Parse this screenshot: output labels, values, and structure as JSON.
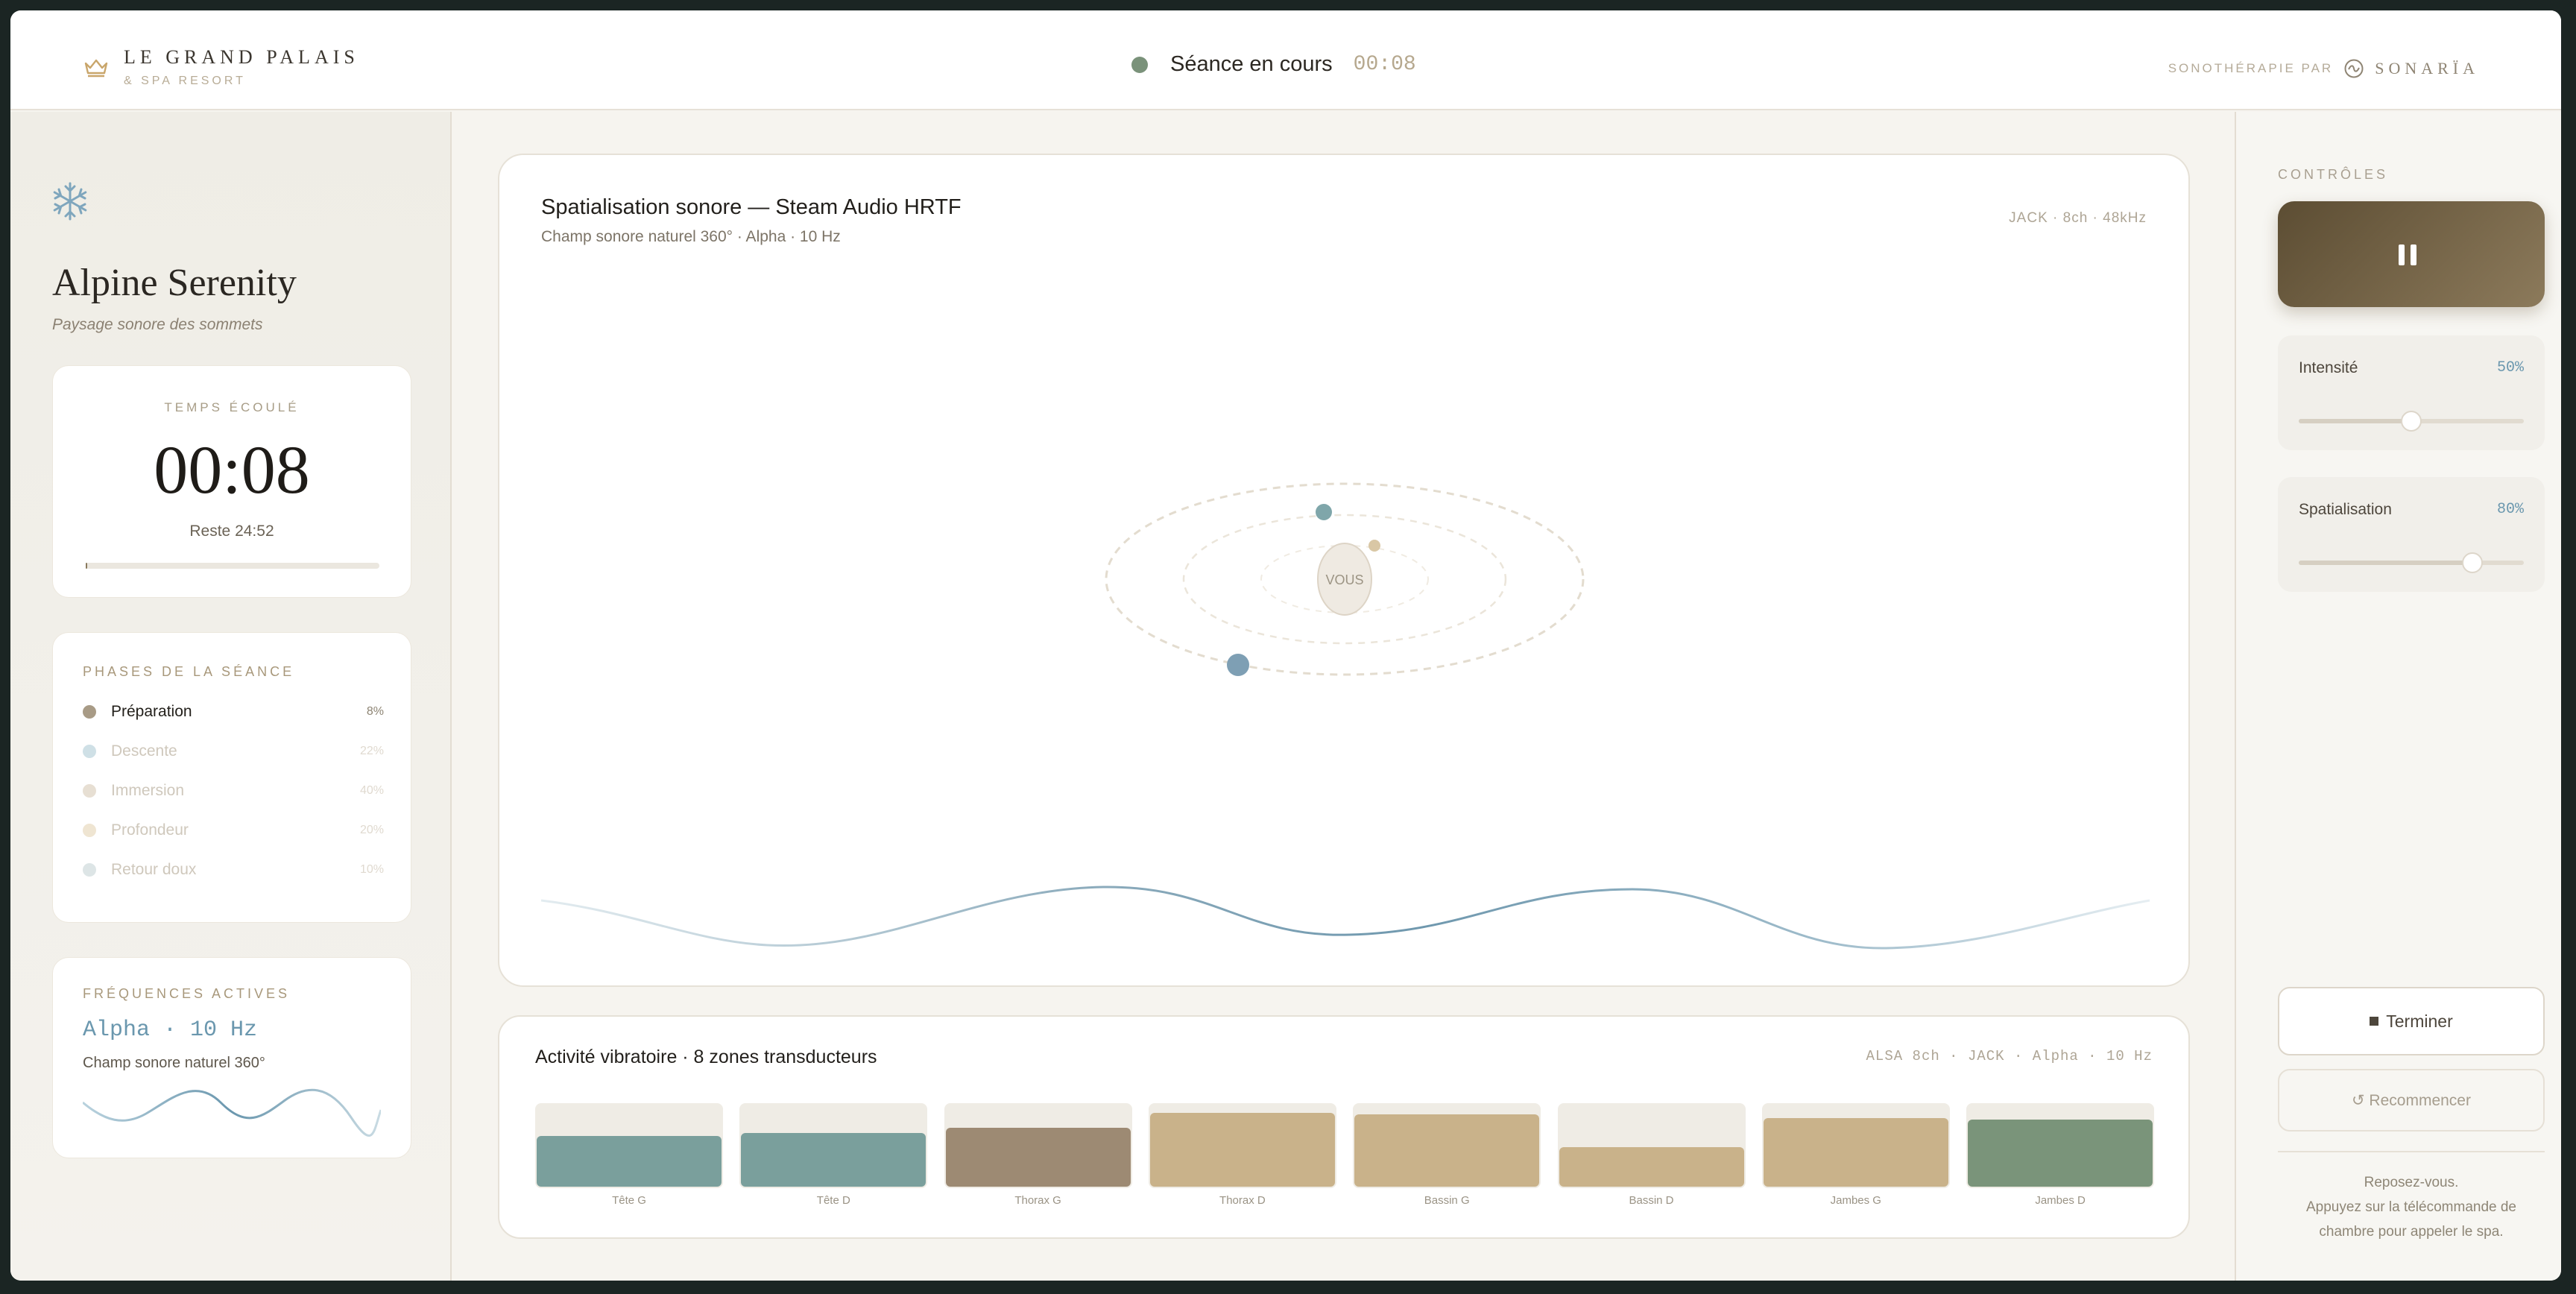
{
  "header": {
    "brand_name": "LE GRAND PALAIS",
    "brand_sub": "& SPA RESORT",
    "session_label": "Séance en cours",
    "session_time": "00:08",
    "powered_prefix": "SONOTHÉRAPIE PAR",
    "powered_name": "SONARÏA",
    "icons": {
      "brand": "crown-icon",
      "status": "status-dot-icon",
      "powered": "wave-circle-icon"
    }
  },
  "session": {
    "icon": "snowflake-icon",
    "title": "Alpine Serenity",
    "subtitle": "Paysage sonore des sommets"
  },
  "timer": {
    "label": "TEMPS ÉCOULÉ",
    "value": "00:08",
    "remaining": "Reste 24:52",
    "progress": 0.005
  },
  "phases": {
    "label": "PHASES DE LA SÉANCE",
    "items": [
      {
        "name": "Préparation",
        "pct": "8%",
        "active": true,
        "color": "#a89b86"
      },
      {
        "name": "Descente",
        "pct": "22%",
        "active": false,
        "color": "#cfe0e6"
      },
      {
        "name": "Immersion",
        "pct": "40%",
        "active": false,
        "color": "#e7dfd3"
      },
      {
        "name": "Profondeur",
        "pct": "20%",
        "active": false,
        "color": "#efe5d2"
      },
      {
        "name": "Retour doux",
        "pct": "10%",
        "active": false,
        "color": "#dde5e6"
      }
    ]
  },
  "frequencies": {
    "label": "FRÉQUENCES ACTIVES",
    "value": "Alpha · 10 Hz",
    "desc": "Champ sonore naturel 360°"
  },
  "spatial": {
    "title": "Spatialisation sonore — Steam Audio HRTF",
    "subtitle": "Champ sonore naturel 360° · Alpha · 10 Hz",
    "tech": "JACK · 8ch · 48kHz",
    "listener": "VOUS"
  },
  "vibration": {
    "title": "Activité vibratoire · 8 zones transducteurs",
    "tech": "ALSA 8ch · JACK · Alpha · 10 Hz",
    "zones": [
      {
        "label": "Tête G",
        "level": 0.62,
        "color": "#7a9f9c"
      },
      {
        "label": "Tête D",
        "level": 0.65,
        "color": "#7a9f9c"
      },
      {
        "label": "Thorax G",
        "level": 0.72,
        "color": "#9d8a73"
      },
      {
        "label": "Thorax D",
        "level": 0.9,
        "color": "#c9b28a"
      },
      {
        "label": "Bassin G",
        "level": 0.88,
        "color": "#c9b28a"
      },
      {
        "label": "Bassin D",
        "level": 0.48,
        "color": "#c9b28a"
      },
      {
        "label": "Jambes G",
        "level": 0.84,
        "color": "#c9b28a"
      },
      {
        "label": "Jambes D",
        "level": 0.82,
        "color": "#7a947a"
      }
    ]
  },
  "controls": {
    "label": "CONTRÔLES",
    "pause_icon": "pause-icon",
    "intensity": {
      "label": "Intensité",
      "value_text": "50%",
      "level": 0.5
    },
    "spatialisation": {
      "label": "Spatialisation",
      "value_text": "80%",
      "level": 0.77
    },
    "end_label": "Terminer",
    "restart_label": "↺ Recommencer",
    "hint": "Reposez-vous.\nAppuyez sur la télécommande de chambre pour appeler le spa."
  }
}
